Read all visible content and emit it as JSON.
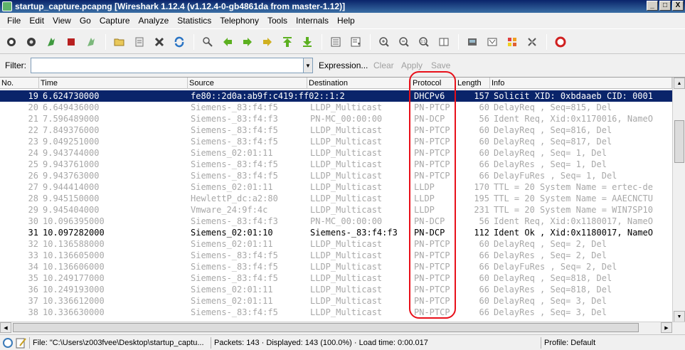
{
  "window": {
    "title": "startup_capture.pcapng   [Wireshark 1.12.4  (v1.12.4-0-gb4861da from master-1.12)]",
    "buttons": [
      "_",
      "□",
      "X"
    ]
  },
  "menu": [
    "File",
    "Edit",
    "View",
    "Go",
    "Capture",
    "Analyze",
    "Statistics",
    "Telephony",
    "Tools",
    "Internals",
    "Help"
  ],
  "toolbar_icons": [
    "interface-list-icon",
    "options-icon",
    "start-capture-icon",
    "stop-capture-icon",
    "restart-capture-icon",
    "open-file-icon",
    "save-file-icon",
    "close-file-icon",
    "reload-icon",
    "find-packet-icon",
    "go-back-icon",
    "go-forward-icon",
    "go-to-packet-icon",
    "go-first-icon",
    "go-last-icon",
    "colorize-icon",
    "auto-scroll-icon",
    "zoom-in-icon",
    "zoom-out-icon",
    "normal-size-icon",
    "resize-columns-icon",
    "capture-filters-icon",
    "display-filters-icon",
    "coloring-rules-icon",
    "preferences-icon",
    "help-icon"
  ],
  "filter": {
    "label": "Filter:",
    "value": "",
    "placeholder": "",
    "expression": "Expression...",
    "clear": "Clear",
    "apply": "Apply",
    "save": "Save"
  },
  "columns": [
    "No.",
    "Time",
    "Source",
    "Destination",
    "Protocol",
    "Length",
    "Info"
  ],
  "packets": [
    {
      "no": "19",
      "time": "6.624730000",
      "src": "fe80::2d0a:ab9f:c419:ff02::1:2",
      "dst": "",
      "proto": "DHCPv6",
      "len": "157",
      "info": "Solicit XID: 0xbdaaeb CID: 0001",
      "style": "sel"
    },
    {
      "no": "20",
      "time": "6.649436000",
      "src": "Siemens-_83:f4:f5",
      "dst": "LLDP_Multicast",
      "proto": "PN-PTCP",
      "len": "60",
      "info": "DelayReq       , Seq=815, Del",
      "style": "dim"
    },
    {
      "no": "21",
      "time": "7.596489000",
      "src": "Siemens-_83:f4:f3",
      "dst": "PN-MC_00:00:00",
      "proto": "PN-DCP",
      "len": "56",
      "info": "Ident Req, Xid:0x1170016, NameO",
      "style": "dim"
    },
    {
      "no": "22",
      "time": "7.849376000",
      "src": "Siemens-_83:f4:f5",
      "dst": "LLDP_Multicast",
      "proto": "PN-PTCP",
      "len": "60",
      "info": "DelayReq       , Seq=816, Del",
      "style": "dim"
    },
    {
      "no": "23",
      "time": "9.049251000",
      "src": "Siemens-_83:f4:f5",
      "dst": "LLDP_Multicast",
      "proto": "PN-PTCP",
      "len": "60",
      "info": "DelayReq       , Seq=817, Del",
      "style": "dim"
    },
    {
      "no": "24",
      "time": "9.943744000",
      "src": "Siemens_02:01:11",
      "dst": "LLDP_Multicast",
      "proto": "PN-PTCP",
      "len": "60",
      "info": "DelayReq       , Seq=  1, Del",
      "style": "dim"
    },
    {
      "no": "25",
      "time": "9.943761000",
      "src": "Siemens-_83:f4:f5",
      "dst": "LLDP_Multicast",
      "proto": "PN-PTCP",
      "len": "66",
      "info": "DelayRes       , Seq=  1, Del",
      "style": "dim"
    },
    {
      "no": "26",
      "time": "9.943763000",
      "src": "Siemens-_83:f4:f5",
      "dst": "LLDP_Multicast",
      "proto": "PN-PTCP",
      "len": "66",
      "info": "DelayFuRes     , Seq=  1, Del",
      "style": "dim"
    },
    {
      "no": "27",
      "time": "9.944414000",
      "src": "Siemens_02:01:11",
      "dst": "LLDP_Multicast",
      "proto": "LLDP",
      "len": "170",
      "info": "TTL = 20 System Name = ertec-de",
      "style": "dim"
    },
    {
      "no": "28",
      "time": "9.945150000",
      "src": "HewlettP_dc:a2:80",
      "dst": "LLDP_Multicast",
      "proto": "LLDP",
      "len": "195",
      "info": "TTL = 20 System Name = AAECNCTU",
      "style": "dim"
    },
    {
      "no": "29",
      "time": "9.945404000",
      "src": "Vmware_24:9f:4c",
      "dst": "LLDP_Multicast",
      "proto": "LLDP",
      "len": "231",
      "info": "TTL = 20 System Name = WIN7SP10",
      "style": "dim"
    },
    {
      "no": "30",
      "time": "10.096395000",
      "src": "Siemens-_83:f4:f3",
      "dst": "PN-MC_00:00:00",
      "proto": "PN-DCP",
      "len": "56",
      "info": "Ident Req, Xid:0x1180017, NameO",
      "style": "dim"
    },
    {
      "no": "31",
      "time": "10.097282000",
      "src": "Siemens_02:01:10",
      "dst": "Siemens-_83:f4:f3",
      "proto": "PN-DCP",
      "len": "112",
      "info": "Ident Ok , Xid:0x1180017, NameO",
      "style": "normal"
    },
    {
      "no": "32",
      "time": "10.136588000",
      "src": "Siemens_02:01:11",
      "dst": "LLDP_Multicast",
      "proto": "PN-PTCP",
      "len": "60",
      "info": "DelayReq       , Seq=  2, Del",
      "style": "dim"
    },
    {
      "no": "33",
      "time": "10.136605000",
      "src": "Siemens-_83:f4:f5",
      "dst": "LLDP_Multicast",
      "proto": "PN-PTCP",
      "len": "66",
      "info": "DelayRes       , Seq=  2, Del",
      "style": "dim"
    },
    {
      "no": "34",
      "time": "10.136606000",
      "src": "Siemens-_83:f4:f5",
      "dst": "LLDP_Multicast",
      "proto": "PN-PTCP",
      "len": "66",
      "info": "DelayFuRes     , Seq=  2, Del",
      "style": "dim"
    },
    {
      "no": "35",
      "time": "10.249177000",
      "src": "Siemens-_83:f4:f5",
      "dst": "LLDP_Multicast",
      "proto": "PN-PTCP",
      "len": "60",
      "info": "DelayReq       , Seq=818, Del",
      "style": "dim"
    },
    {
      "no": "36",
      "time": "10.249193000",
      "src": "Siemens_02:01:11",
      "dst": "LLDP_Multicast",
      "proto": "PN-PTCP",
      "len": "66",
      "info": "DelayRes       , Seq=818, Del",
      "style": "dim"
    },
    {
      "no": "37",
      "time": "10.336612000",
      "src": "Siemens_02:01:11",
      "dst": "LLDP_Multicast",
      "proto": "PN-PTCP",
      "len": "60",
      "info": "DelayReq       , Seq=  3, Del",
      "style": "dim"
    },
    {
      "no": "38",
      "time": "10.336630000",
      "src": "Siemens-_83:f4:f5",
      "dst": "LLDP_Multicast",
      "proto": "PN-PTCP",
      "len": "66",
      "info": "DelayRes       , Seq=  3, Del",
      "style": "dim"
    }
  ],
  "status": {
    "file": "File: \"C:\\Users\\z003fvee\\Desktop\\startup_captu...",
    "packets": "Packets: 143 · Displayed: 143 (100.0%) · Load time: 0:00.017",
    "profile": "Profile: Default"
  },
  "colors": {
    "selection": "#0a246a",
    "annotation": "#e8101a"
  }
}
